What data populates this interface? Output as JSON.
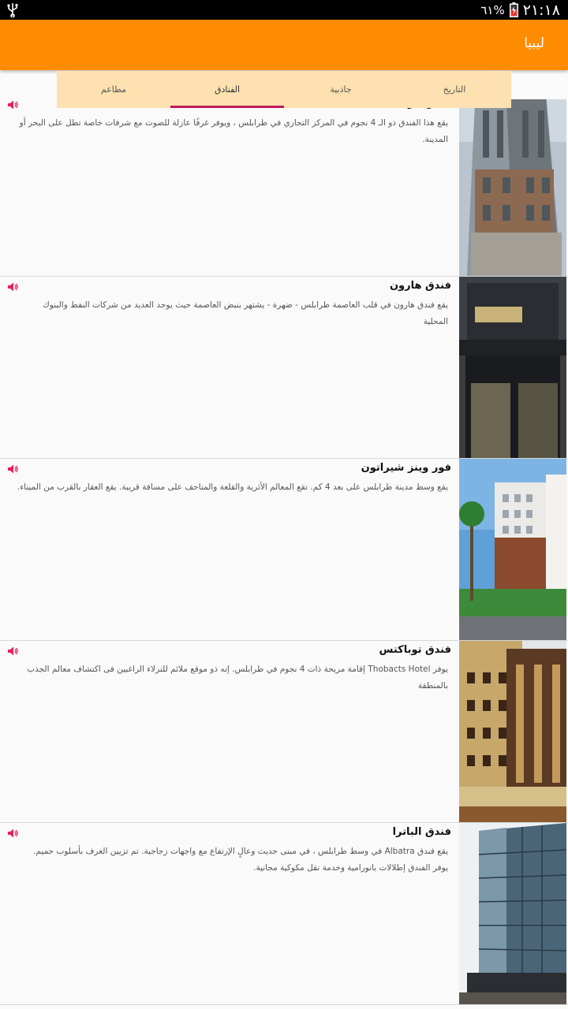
{
  "status_bar": {
    "battery_percent": "٦١%",
    "time": "٢١:١٨"
  },
  "app_bar": {
    "title": "ليبيا"
  },
  "tabs": [
    {
      "label": "التاريخ",
      "active": false
    },
    {
      "label": "جاذبية",
      "active": false
    },
    {
      "label": "الفنادق",
      "active": true
    },
    {
      "label": "مطاعم",
      "active": false
    }
  ],
  "hotels": [
    {
      "name": "فندق الريان",
      "description": "يقع هذا الفندق ذو الـ 4 نجوم في المركز التجاري في طرابلس ، ويوفر غرفًا عازلة للصوت مع شرفات خاصة تطل على البحر أو المدينة."
    },
    {
      "name": "فندق هارون",
      "description": "يقع فندق هارون في قلب العاصمة طرابلس - ضهرة - يشتهر بنبض العاصمة حيث يوجد العديد من شركات النفط والبنوك المحلية"
    },
    {
      "name": "فور وينز شيراتون",
      "description": "يقع وسط مدينة طرابلس على بعد 4 كم. تقع المعالم الأثرية والقلعة والمتاحف على مسافة قريبة. يقع العقار بالقرب من الميناء."
    },
    {
      "name": "فندق توباكتس",
      "description": "يوفر Thobacts Hotel إقامة مريحة ذات 4 نجوم في طرابلس. إنه ذو موقع ملائم للنزلاء الراغبين فى اكتشاف معالم الجذب بالمنطقة"
    },
    {
      "name": "فندق الباترا",
      "description": "يقع فندق Albatra في وسط طرابلس ، في مبنى حديث وعالٍ الإرتفاع مع واجهات زجاجية. تم تزيين الغرف بأسلوب حميم. يوفر الفندق إطلالات بانورامية وخدمة نقل مكوكية مجانية."
    }
  ],
  "colors": {
    "app_bar": "#ff8c00",
    "tab_background": "#fde1b0",
    "tab_indicator": "#c2185b",
    "speaker_icon": "#e91e63"
  }
}
